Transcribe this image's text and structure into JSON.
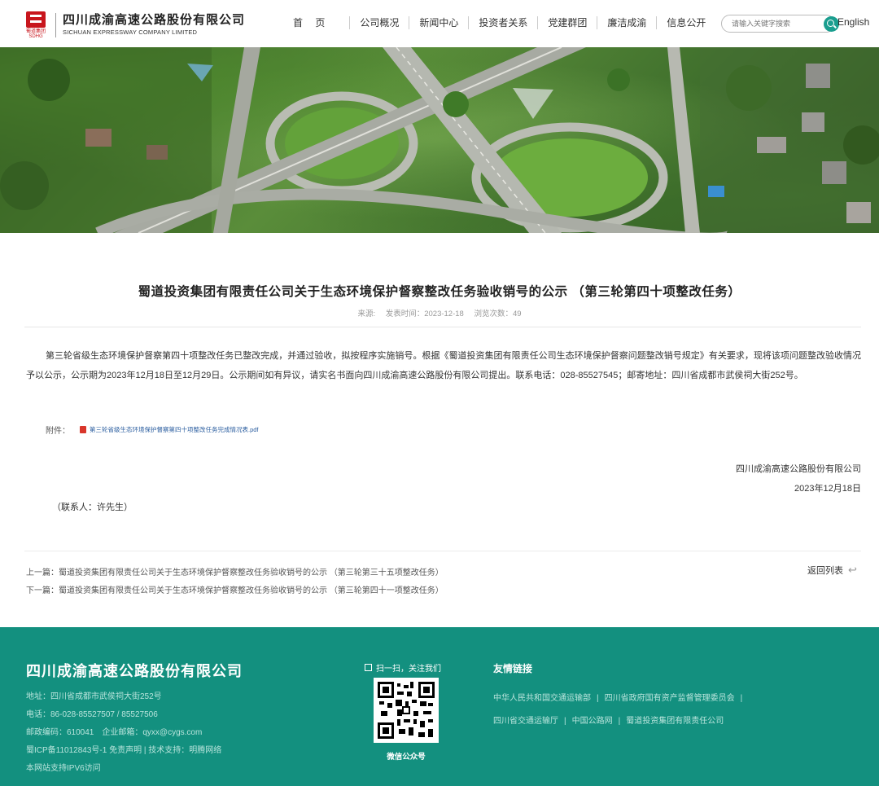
{
  "header": {
    "logo_mark_sub": "蜀道集团\nSDHG",
    "company_cn": "四川成渝高速公路股份有限公司",
    "company_en": "SICHUAN EXPRESSWAY COMPANY LIMITED",
    "nav": [
      "首 页",
      "公司概况",
      "新闻中心",
      "投资者关系",
      "党建群团",
      "廉洁成渝",
      "信息公开"
    ],
    "search_placeholder": "请输入关键字搜索",
    "lang": "English"
  },
  "article": {
    "title": "蜀道投资集团有限责任公司关于生态环境保护督察整改任务验收销号的公示 （第三轮第四十项整改任务）",
    "meta_source": "来源:",
    "meta_time": "发表时间：2023-12-18",
    "meta_views": "浏览次数：49",
    "body": "第三轮省级生态环境保护督察第四十项整改任务已整改完成，并通过验收，拟按程序实施销号。根据《蜀道投资集团有限责任公司生态环境保护督察问题整改销号规定》有关要求，现将该项问题整改验收情况予以公示，公示期为2023年12月18日至12月29日。公示期间如有异议，请实名书面向四川成渝高速公路股份有限公司提出。联系电话：028-85527545；邮寄地址：四川省成都市武侯祠大街252号。",
    "attachment_label": "附件：",
    "attachment_file": "第三轮省级生态环境保护督察第四十项整改任务完成情况表.pdf",
    "sign_org": "四川成渝高速公路股份有限公司",
    "sign_date": "2023年12月18日",
    "contact": "（联系人：许先生）",
    "prev": "上一篇：蜀道投资集团有限责任公司关于生态环境保护督察整改任务验收销号的公示 （第三轮第三十五项整改任务）",
    "next": "下一篇：蜀道投资集团有限责任公司关于生态环境保护督察整改任务验收销号的公示 （第三轮第四十一项整改任务）",
    "back": "返回列表"
  },
  "footer": {
    "company": "四川成渝高速公路股份有限公司",
    "address": "地址：四川省成都市武侯祠大街252号",
    "phone": "电话：86-028-85527507 / 85527506",
    "postal": "邮政编码：610041　企业邮箱：qyxx@cygs.com",
    "icp": "蜀ICP备11012843号-1 免责声明 | 技术支持：明腾网络",
    "ipv6": "本网站支持IPV6访问",
    "qr_title": "扫一扫，关注我们",
    "qr_label": "微信公众号",
    "links_title": "友情链接",
    "links_row1": [
      "中华人民共和国交通运输部",
      "四川省政府国有资产监督管理委员会"
    ],
    "links_row2": [
      "四川省交通运输厅",
      "中国公路网",
      "蜀道投资集团有限责任公司"
    ]
  },
  "colors": {
    "footer_bg": "#13907f",
    "accent": "#1a9e8f",
    "logo_red": "#c8161d"
  }
}
